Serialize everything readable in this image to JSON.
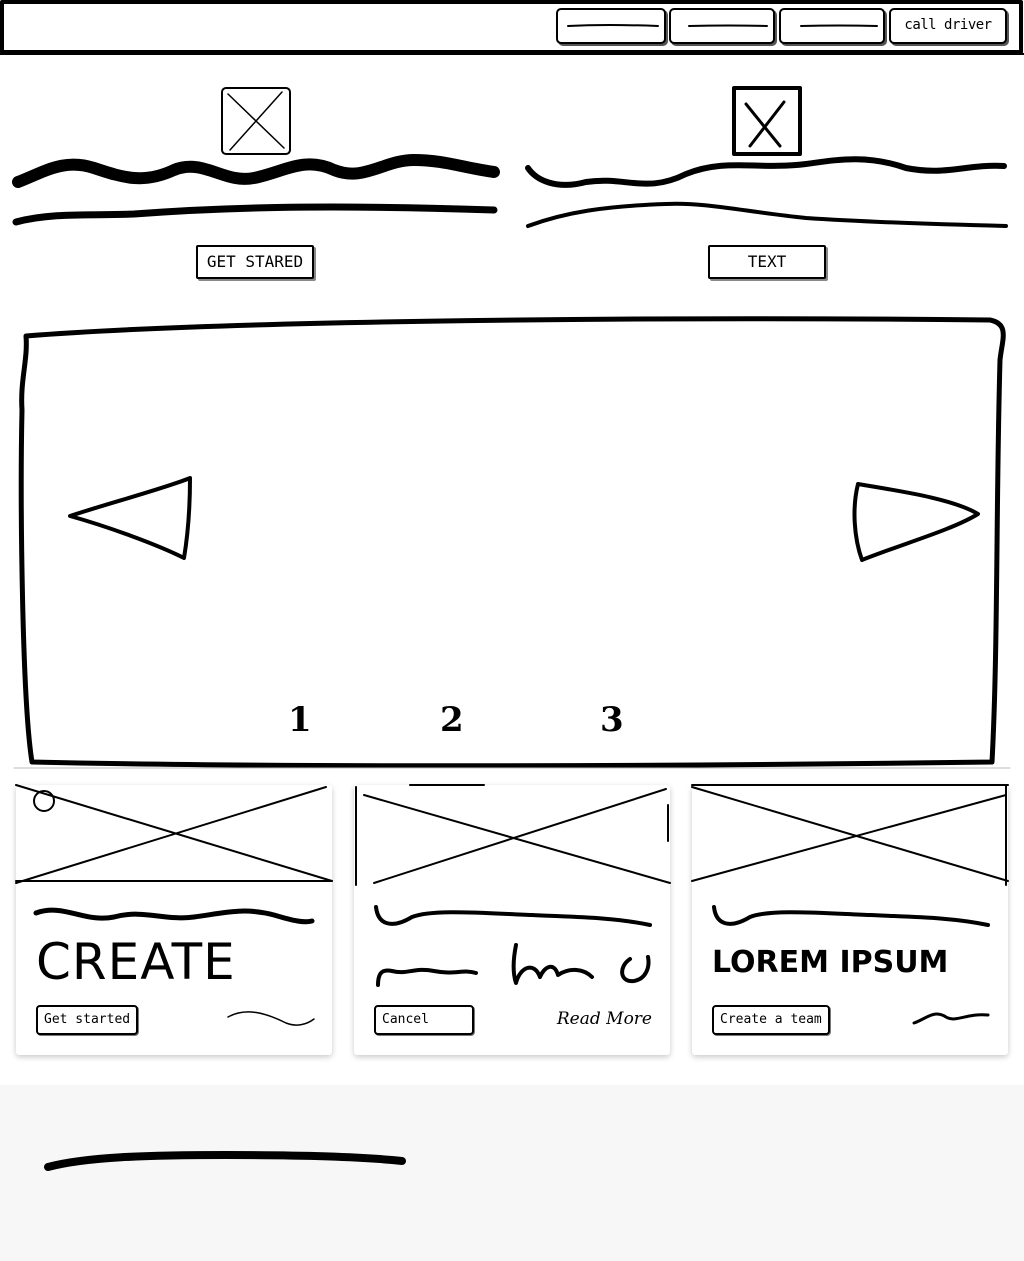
{
  "navbar": {
    "items": [
      {
        "label": ""
      },
      {
        "label": ""
      },
      {
        "label": ""
      },
      {
        "label": "call driver"
      }
    ]
  },
  "features": [
    {
      "button_label": "GET STARED"
    },
    {
      "button_label": "TEXT"
    }
  ],
  "carousel": {
    "pages": [
      "1",
      "2",
      "3"
    ]
  },
  "cards": [
    {
      "headline": "CREATE",
      "button_label": "Get started",
      "link_text": ""
    },
    {
      "headline": "",
      "button_label": "Cancel",
      "link_text": "Read More"
    },
    {
      "headline": "LOREM IPSUM",
      "button_label": "Create a team",
      "link_text": ""
    }
  ]
}
